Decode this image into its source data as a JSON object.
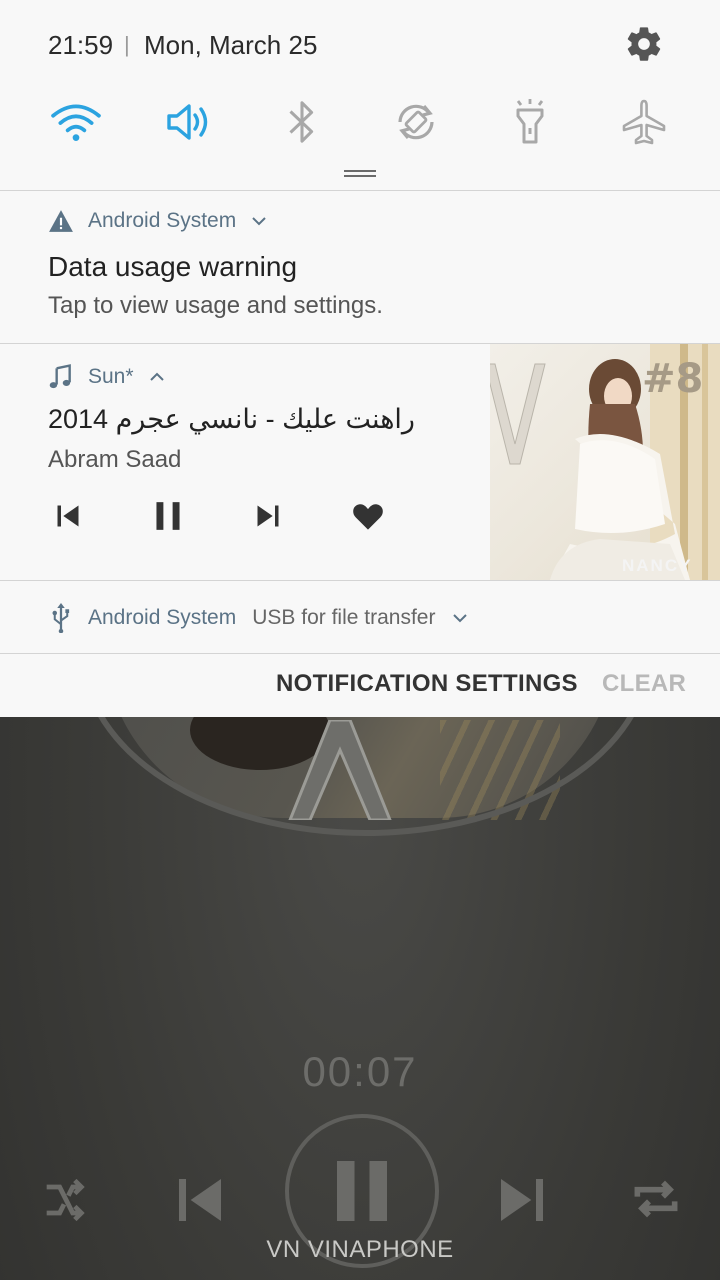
{
  "status_bar": {
    "time": "21:59",
    "separator": "|",
    "date": "Mon, March 25"
  },
  "quick_settings": [
    {
      "name": "wifi",
      "icon": "wifi-icon",
      "state": "on"
    },
    {
      "name": "sound",
      "icon": "volume-icon",
      "state": "on"
    },
    {
      "name": "bluetooth",
      "icon": "bluetooth-icon",
      "state": "off"
    },
    {
      "name": "auto-rotate",
      "icon": "rotate-icon",
      "state": "off"
    },
    {
      "name": "flashlight",
      "icon": "flashlight-icon",
      "state": "off"
    },
    {
      "name": "airplane-mode",
      "icon": "airplane-icon",
      "state": "off"
    }
  ],
  "colors": {
    "accent": "#2ba3e0",
    "inactive_icon": "#a8a8a8",
    "app_label": "#5b7386",
    "clear_disabled": "#b8b8b8"
  },
  "notifications": {
    "data_warning": {
      "app": "Android System",
      "icon": "warning-icon",
      "title": "Data usage warning",
      "text": "Tap to view usage and settings."
    },
    "media": {
      "app": "Sun*",
      "icon": "music-note-icon",
      "title": "راهنت عليك - نانسي عجرم 2014",
      "artist": "Abram Saad",
      "album_art_text": "#8",
      "album_art_label": "NANCY",
      "controls": [
        "previous-icon",
        "pause-icon",
        "next-icon",
        "heart-icon"
      ]
    },
    "usb": {
      "app": "Android System",
      "icon": "usb-icon",
      "text": "USB for file transfer"
    }
  },
  "footer": {
    "settings_label": "NOTIFICATION SETTINGS",
    "clear_label": "CLEAR"
  },
  "player_background": {
    "elapsed_time": "00:07",
    "carrier": "VN VINAPHONE"
  }
}
